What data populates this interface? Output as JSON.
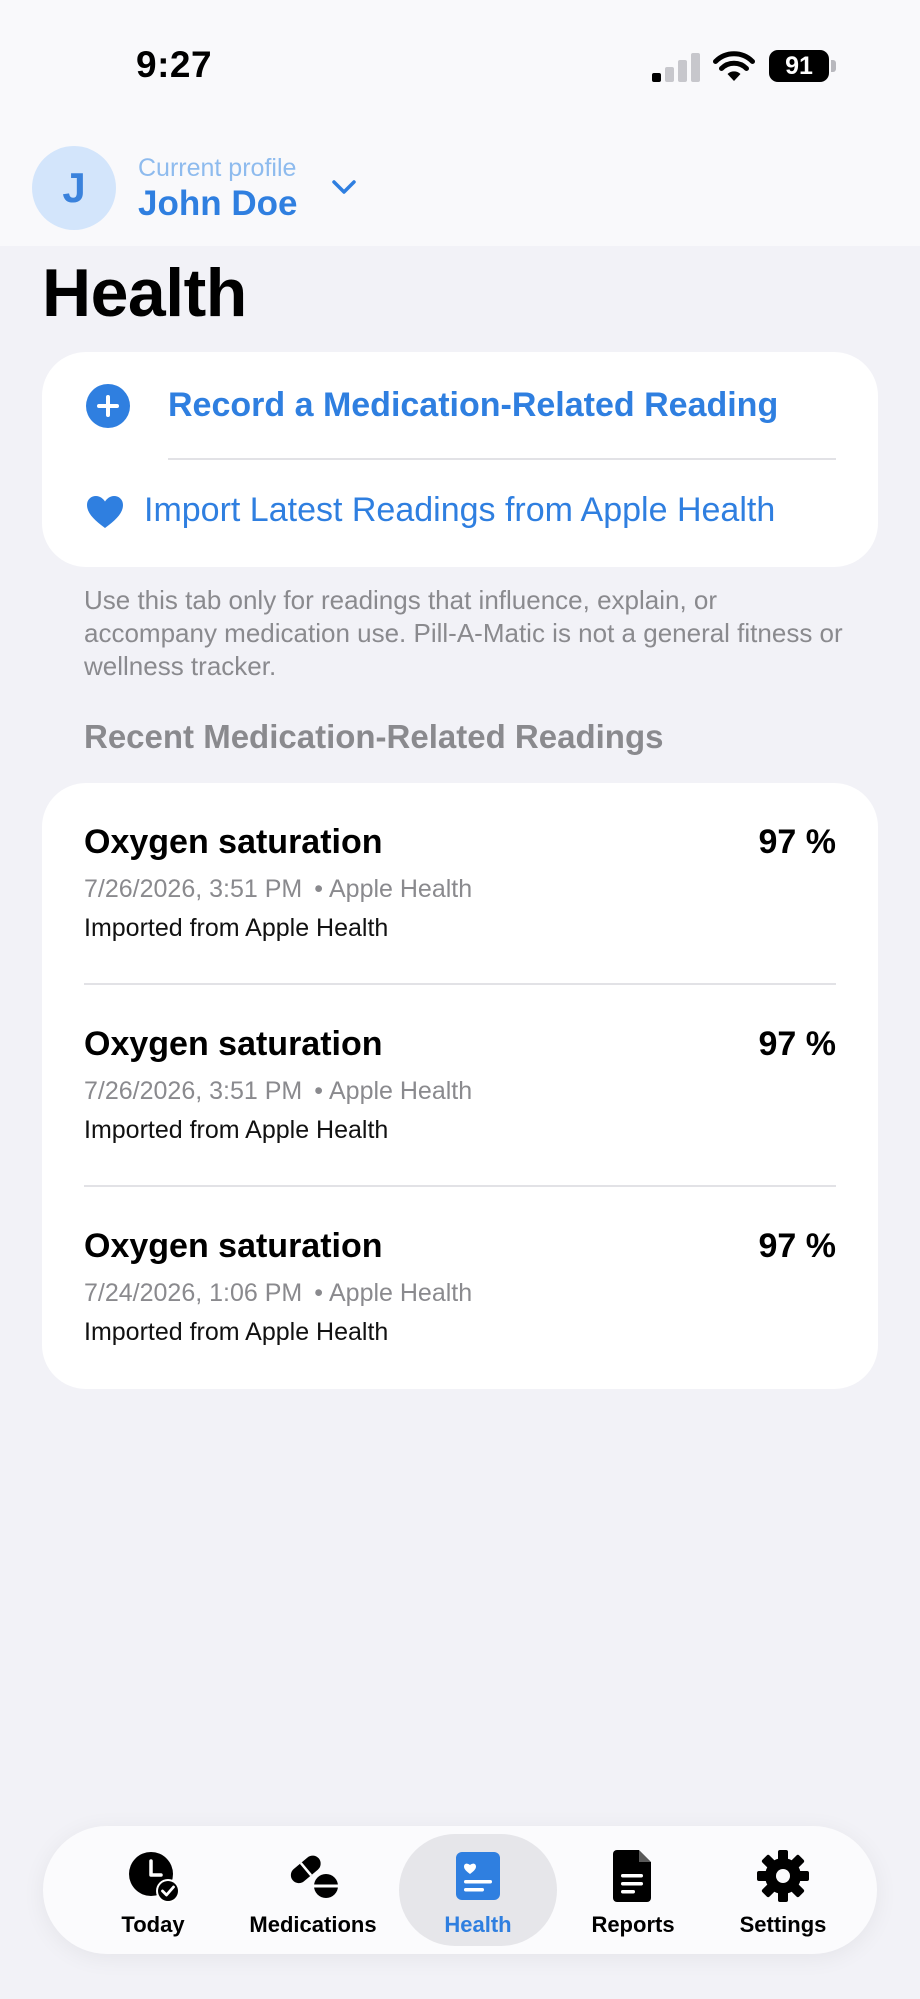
{
  "status_bar": {
    "time": "9:27",
    "battery_level": "91",
    "signal_bars_active": 1,
    "signal_bars_total": 4
  },
  "profile": {
    "avatar_initial": "J",
    "caption": "Current profile",
    "name": "John Doe"
  },
  "page": {
    "title": "Health"
  },
  "actions": {
    "record_label": "Record a Medication-Related Reading",
    "import_label": "Import Latest Readings from Apple Health"
  },
  "note": "Use this tab only for readings that influence, explain, or accompany medication use. Pill-A-Matic is not a general fitness or wellness tracker.",
  "readings": {
    "header": "Recent Medication-Related Readings",
    "items": [
      {
        "name": "Oxygen saturation",
        "value": "97 %",
        "datetime": "7/26/2026, 3:51 PM",
        "separator": "•",
        "source": "Apple Health",
        "note": "Imported from Apple Health"
      },
      {
        "name": "Oxygen saturation",
        "value": "97 %",
        "datetime": "7/26/2026, 3:51 PM",
        "separator": "•",
        "source": "Apple Health",
        "note": "Imported from Apple Health"
      },
      {
        "name": "Oxygen saturation",
        "value": "97 %",
        "datetime": "7/24/2026, 1:06 PM",
        "separator": "•",
        "source": "Apple Health",
        "note": "Imported from Apple Health"
      }
    ]
  },
  "tabs": [
    {
      "label": "Today",
      "icon": "clock-check-icon",
      "active": false
    },
    {
      "label": "Medications",
      "icon": "pills-icon",
      "active": false
    },
    {
      "label": "Health",
      "icon": "health-record-icon",
      "active": true
    },
    {
      "label": "Reports",
      "icon": "document-icon",
      "active": false
    },
    {
      "label": "Settings",
      "icon": "gear-icon",
      "active": false
    }
  ],
  "colors": {
    "accent": "#2f7fe0",
    "background": "#f2f2f7",
    "card": "#ffffff",
    "secondary_text": "#8a8a8e"
  }
}
